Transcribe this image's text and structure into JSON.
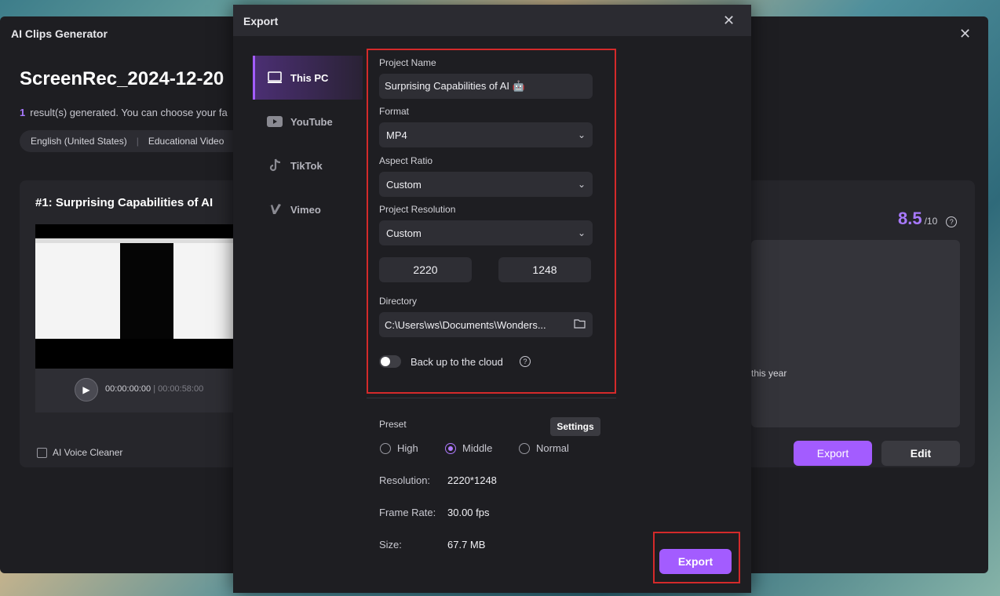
{
  "background": {
    "window_title": "AI Clips Generator",
    "heading": "ScreenRec_2024-12-20",
    "result_count": "1",
    "result_text": "result(s) generated. You can choose your fa",
    "tags": [
      "English (United States)",
      "Educational Video"
    ],
    "card_title": "#1:  Surprising Capabilities of AI",
    "time_current": "00:00:00:00",
    "time_total": "00:00:58:00",
    "voice_cleaner_label": "AI Voice Cleaner",
    "score_value": "8.5",
    "score_denominator": "/10",
    "description_fragment": "this year",
    "export_label": "Export",
    "edit_label": "Edit"
  },
  "dialog": {
    "title": "Export",
    "nav": [
      {
        "label": "This PC",
        "icon": "laptop-icon",
        "active": true
      },
      {
        "label": "YouTube",
        "icon": "youtube-icon",
        "active": false
      },
      {
        "label": "TikTok",
        "icon": "tiktok-icon",
        "active": false
      },
      {
        "label": "Vimeo",
        "icon": "vimeo-icon",
        "active": false
      }
    ],
    "project_name_label": "Project Name",
    "project_name_value": "Surprising Capabilities of AI 🤖",
    "format_label": "Format",
    "format_value": "MP4",
    "aspect_label": "Aspect Ratio",
    "aspect_value": "Custom",
    "resolution_label": "Project Resolution",
    "resolution_value": "Custom",
    "width_value": "2220",
    "height_value": "1248",
    "directory_label": "Directory",
    "directory_value": "C:\\Users\\ws\\Documents\\Wonders...",
    "backup_label": "Back up to the cloud",
    "backup_enabled": false,
    "preset_label": "Preset",
    "settings_label": "Settings",
    "presets": [
      {
        "label": "High",
        "selected": false
      },
      {
        "label": "Middle",
        "selected": true
      },
      {
        "label": "Normal",
        "selected": false
      }
    ],
    "info": [
      {
        "label": "Resolution:",
        "value": "2220*1248"
      },
      {
        "label": "Frame Rate:",
        "value": "30.00 fps"
      },
      {
        "label": "Size:",
        "value": "67.7 MB"
      }
    ],
    "export_label": "Export"
  },
  "colors": {
    "accent": "#a35cff",
    "highlight_border": "#d42a2a",
    "panel": "#1e1e22"
  }
}
